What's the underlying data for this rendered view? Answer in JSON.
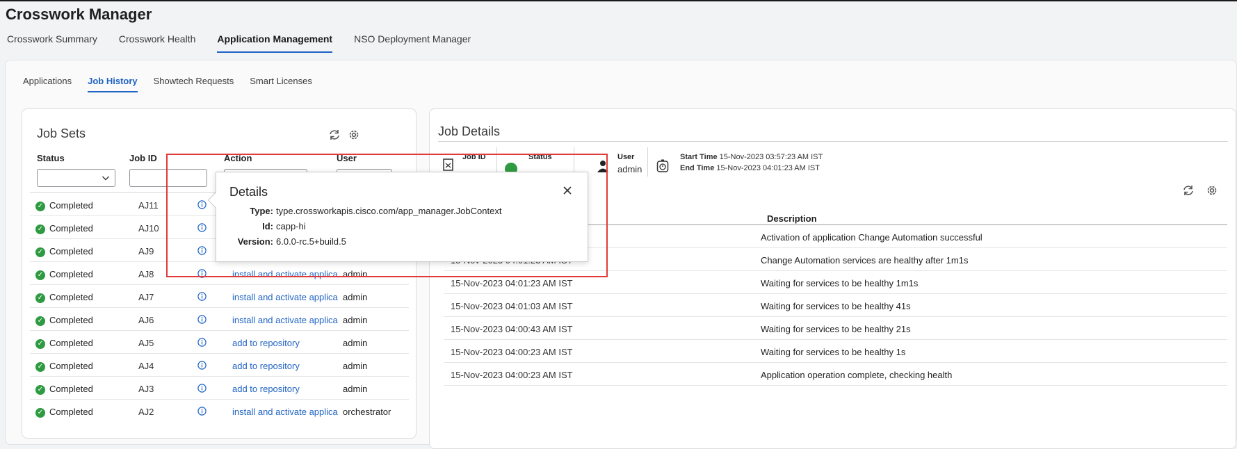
{
  "app": {
    "title": "Crosswork Manager"
  },
  "main_tabs": [
    {
      "label": "Crosswork Summary",
      "active": false
    },
    {
      "label": "Crosswork Health",
      "active": false
    },
    {
      "label": "Application Management",
      "active": true
    },
    {
      "label": "NSO Deployment Manager",
      "active": false
    }
  ],
  "sub_tabs": [
    {
      "label": "Applications",
      "active": false
    },
    {
      "label": "Job History",
      "active": true
    },
    {
      "label": "Showtech Requests",
      "active": false
    },
    {
      "label": "Smart Licenses",
      "active": false
    }
  ],
  "job_sets": {
    "title": "Job Sets",
    "columns": {
      "status": "Status",
      "job_id": "Job ID",
      "action": "Action",
      "user": "User"
    },
    "rows": [
      {
        "status": "Completed",
        "job_id": "AJ11",
        "action": "",
        "user": ""
      },
      {
        "status": "Completed",
        "job_id": "AJ10",
        "action": "",
        "user": ""
      },
      {
        "status": "Completed",
        "job_id": "AJ9",
        "action": "",
        "user": ""
      },
      {
        "status": "Completed",
        "job_id": "AJ8",
        "action": "install and activate applica",
        "user": "admin"
      },
      {
        "status": "Completed",
        "job_id": "AJ7",
        "action": "install and activate applica",
        "user": "admin"
      },
      {
        "status": "Completed",
        "job_id": "AJ6",
        "action": "install and activate applica",
        "user": "admin"
      },
      {
        "status": "Completed",
        "job_id": "AJ5",
        "action": "add to repository",
        "user": "admin"
      },
      {
        "status": "Completed",
        "job_id": "AJ4",
        "action": "add to repository",
        "user": "admin"
      },
      {
        "status": "Completed",
        "job_id": "AJ3",
        "action": "add to repository",
        "user": "admin"
      },
      {
        "status": "Completed",
        "job_id": "AJ2",
        "action": "install and activate applica",
        "user": "orchestrator"
      }
    ]
  },
  "details_popover": {
    "title": "Details",
    "type_label": "Type:",
    "type_value": "type.crossworkapis.cisco.com/app_manager.JobContext",
    "id_label": "Id:",
    "id_value": "capp-hi",
    "version_label": "Version:",
    "version_value": "6.0.0-rc.5+build.5"
  },
  "job_details": {
    "title": "Job Details",
    "job_id_label": "Job ID",
    "status_label": "Status",
    "user_label": "User",
    "user_value": "admin",
    "start_time_label": "Start Time",
    "start_time_value": "15-Nov-2023 03:57:23 AM IST",
    "end_time_label": "End Time",
    "end_time_value": "15-Nov-2023 04:01:23 AM IST",
    "description_header": "Description",
    "rows": [
      {
        "time": "",
        "description": "Activation of application Change Automation successful"
      },
      {
        "time": "15-Nov-2023 04:01:23 AM IST",
        "description": "Change Automation services are healthy after 1m1s"
      },
      {
        "time": "15-Nov-2023 04:01:23 AM IST",
        "description": "Waiting for services to be healthy 1m1s"
      },
      {
        "time": "15-Nov-2023 04:01:03 AM IST",
        "description": "Waiting for services to be healthy 41s"
      },
      {
        "time": "15-Nov-2023 04:00:43 AM IST",
        "description": "Waiting for services to be healthy 21s"
      },
      {
        "time": "15-Nov-2023 04:00:23 AM IST",
        "description": "Waiting for services to be healthy 1s"
      },
      {
        "time": "15-Nov-2023 04:00:23 AM IST",
        "description": "Application operation complete, checking health"
      }
    ]
  },
  "colors": {
    "accent": "#1f63c4",
    "success": "#2e9a41",
    "highlight": "#e23a3a"
  }
}
